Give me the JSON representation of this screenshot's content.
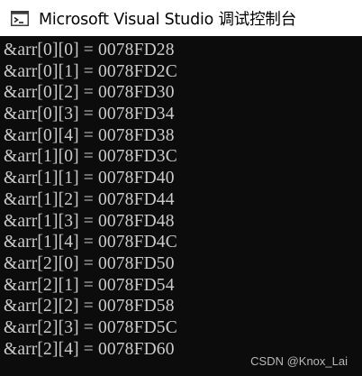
{
  "window": {
    "title": "Microsoft Visual Studio 调试控制台",
    "icon": "console-app-icon"
  },
  "console": {
    "lines": [
      "&arr[0][0] = 0078FD28",
      "&arr[0][1] = 0078FD2C",
      "&arr[0][2] = 0078FD30",
      "&arr[0][3] = 0078FD34",
      "&arr[0][4] = 0078FD38",
      "&arr[1][0] = 0078FD3C",
      "&arr[1][1] = 0078FD40",
      "&arr[1][2] = 0078FD44",
      "&arr[1][3] = 0078FD48",
      "&arr[1][4] = 0078FD4C",
      "&arr[2][0] = 0078FD50",
      "&arr[2][1] = 0078FD54",
      "&arr[2][2] = 0078FD58",
      "&arr[2][3] = 0078FD5C",
      "&arr[2][4] = 0078FD60"
    ],
    "text_color": "#cccccc",
    "background_color": "#0c0c0c"
  },
  "watermark": {
    "text": "CSDN @Knox_Lai"
  }
}
